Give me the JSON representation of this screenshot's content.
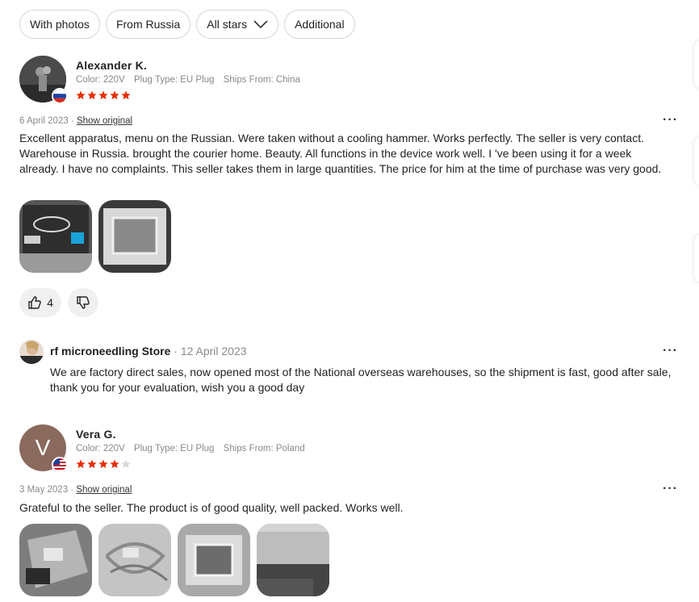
{
  "filters": [
    {
      "label": "With photos"
    },
    {
      "label": "From Russia"
    },
    {
      "label": "All stars"
    },
    {
      "label": "Additional"
    }
  ],
  "reviews": [
    {
      "author": "Alexander K.",
      "country_flag": "russia-flag-icon",
      "props": [
        "Color: 220V",
        "Plug Type: EU Plug",
        "Ships From: China"
      ],
      "rating": 5,
      "date": "6 April 2023",
      "show_original": "Show original",
      "text": "Excellent apparatus, menu on the Russian. Were taken without a cooling hammer. Works perfectly. The seller is very contact. Warehouse in Russia. brought the courier home. Beauty. All functions in the device work well. I 've been using it for a week already. I have no complaints. This seller takes them in large quantities. The price for him at the time of purchase was very good.",
      "likes": "4",
      "reply": {
        "seller": "rf microneedling Store",
        "date": "12 April 2023",
        "text": "We are factory direct sales, now opened most of the National overseas warehouses, so the shipment is fast, good after sale, thank you for your evaluation, wish you a good day"
      }
    },
    {
      "author": "Vera G.",
      "avatar_letter": "V",
      "country_flag": "usa-flag-icon",
      "props": [
        "Color: 220V",
        "Plug Type: EU Plug",
        "Ships From: Poland"
      ],
      "rating": 4,
      "date": "3 May 2023",
      "show_original": "Show original",
      "text": "Grateful to the seller. The product is of good quality, well packed. Works well."
    }
  ],
  "colors": {
    "star": "#e62e04",
    "star_empty": "#d9d9d9",
    "avatar_v": "#8b6a5e"
  },
  "date_separator": " · "
}
